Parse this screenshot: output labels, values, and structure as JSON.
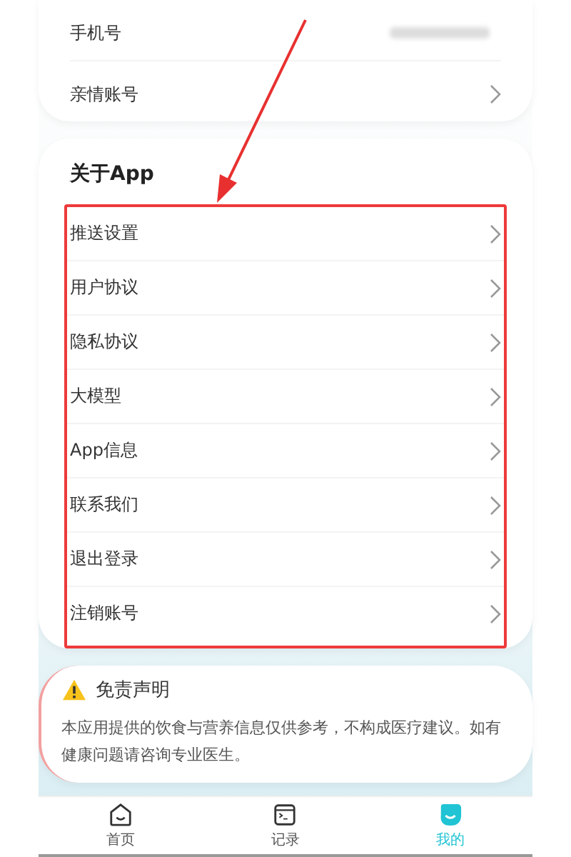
{
  "account_rows": [
    {
      "label": "手机号",
      "kind": "value"
    },
    {
      "label": "亲情账号",
      "kind": "link"
    }
  ],
  "about": {
    "title": "关于App",
    "items": [
      "推送设置",
      "用户协议",
      "隐私协议",
      "大模型",
      "App信息",
      "联系我们",
      "退出登录",
      "注销账号"
    ]
  },
  "disclaimer": {
    "title": "免责声明",
    "text": "本应用提供的饮食与营养信息仅供参考，不构成医疗建议。如有健康问题请咨询专业医生。"
  },
  "tabs": [
    {
      "label": "首页",
      "kind": "home",
      "selected": false
    },
    {
      "label": "记录",
      "kind": "record",
      "selected": false
    },
    {
      "label": "我的",
      "kind": "me",
      "selected": true
    }
  ]
}
